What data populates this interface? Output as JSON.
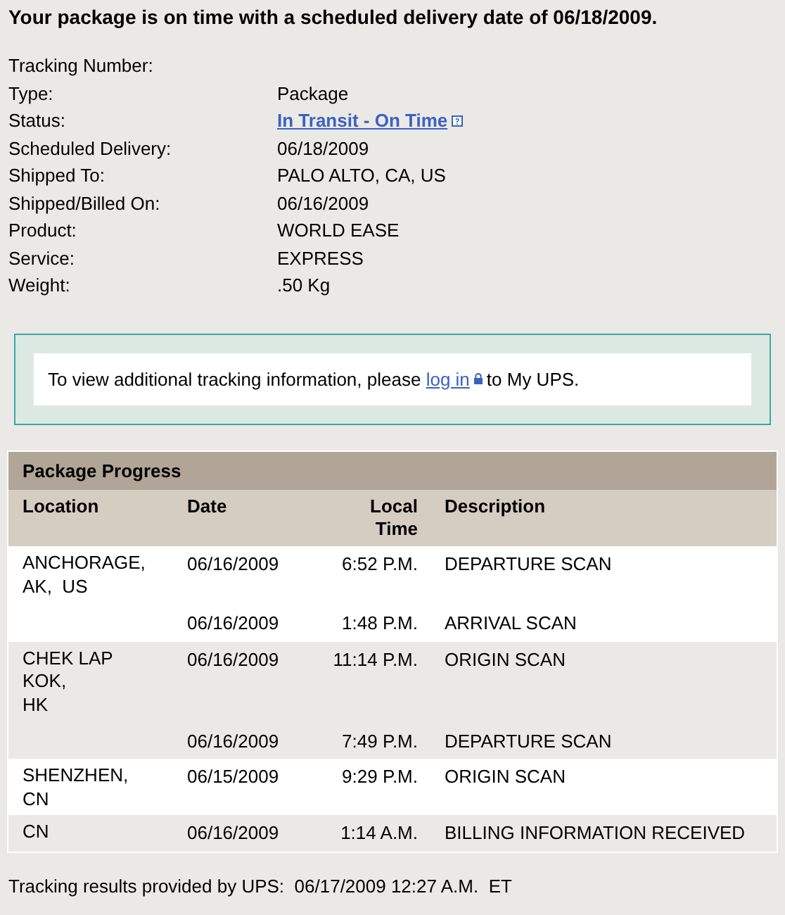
{
  "headline": "Your package is on time with a scheduled delivery date of 06/18/2009.",
  "details": [
    {
      "label": "Tracking Number:"
    },
    {
      "label": "Type:",
      "value": "Package"
    },
    {
      "label": "Status:",
      "value": "In Transit - On Time",
      "kind": "link"
    },
    {
      "label": "Scheduled Delivery:",
      "value": "06/18/2009"
    },
    {
      "label": "Shipped To:",
      "value": "PALO ALTO, CA, US"
    },
    {
      "label": "Shipped/Billed On:",
      "value": "06/16/2009"
    },
    {
      "label": "Product:",
      "value": "WORLD EASE"
    },
    {
      "label": "Service:",
      "value": "EXPRESS"
    },
    {
      "label": "Weight:",
      "value": ".50 Kg"
    }
  ],
  "notice": {
    "before": "To view additional tracking information, please",
    "link": "log in",
    "after": "to My UPS."
  },
  "progress": {
    "title": "Package Progress",
    "columns": [
      "Location",
      "Date",
      "Local Time",
      "Description"
    ],
    "groups": [
      {
        "location": [
          "ANCHORAGE,",
          "AK,  US"
        ],
        "events": [
          {
            "date": "06/16/2009",
            "time": "6:52 P.M.",
            "description": "DEPARTURE SCAN"
          },
          {
            "date": "06/16/2009",
            "time": "1:48 P.M.",
            "description": "ARRIVAL SCAN"
          }
        ]
      },
      {
        "location": [
          "CHEK LAP",
          "KOK,",
          "HK"
        ],
        "events": [
          {
            "date": "06/16/2009",
            "time": "11:14 P.M.",
            "description": "ORIGIN SCAN"
          },
          {
            "date": "06/16/2009",
            "time": "7:49 P.M.",
            "description": "DEPARTURE SCAN"
          }
        ]
      },
      {
        "location": [
          "SHENZHEN,",
          "CN"
        ],
        "events": [
          {
            "date": "06/15/2009",
            "time": "9:29 P.M.",
            "description": "ORIGIN SCAN"
          }
        ]
      },
      {
        "location": [
          "CN"
        ],
        "events": [
          {
            "date": "06/16/2009",
            "time": "1:14 A.M.",
            "description": "BILLING INFORMATION RECEIVED"
          }
        ]
      }
    ]
  },
  "footer": {
    "label": "Tracking results provided by UPS:",
    "timestamp": "06/17/2009 12:27 A.M.  ET"
  }
}
